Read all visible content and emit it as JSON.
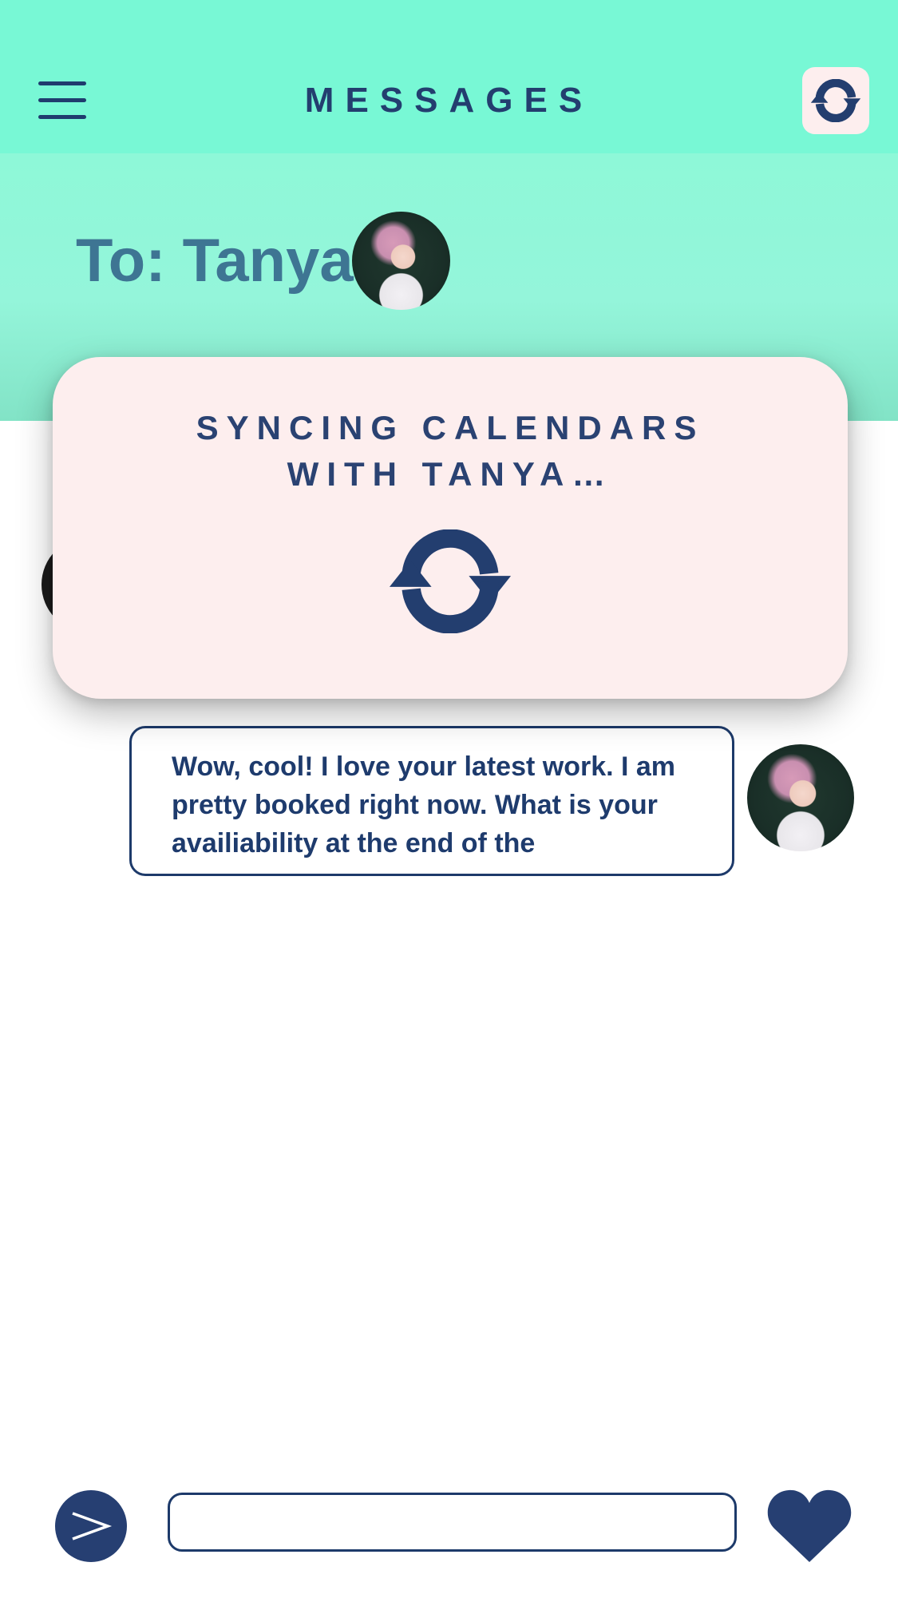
{
  "header": {
    "title": "MESSAGES",
    "menu_icon": "hamburger-menu-icon",
    "sync_icon": "sync-icon"
  },
  "recipient": {
    "label": "To: Tanya"
  },
  "modal": {
    "title_line1": "SYNCING CALENDARS",
    "title_line2": "WITH TANYA…",
    "icon": "sync-icon"
  },
  "messages": [
    {
      "text": "Wow, cool! I love your latest work.  I am pretty booked right now. What is your availiability at the end of the"
    }
  ],
  "composer": {
    "send_icon": "send-icon",
    "input_value": "",
    "like_icon": "heart-icon"
  },
  "colors": {
    "header_bg": "#78f8d5",
    "navy": "#233e6f",
    "modal_bg": "#fdeeee",
    "recipient_text": "#3e7593"
  }
}
